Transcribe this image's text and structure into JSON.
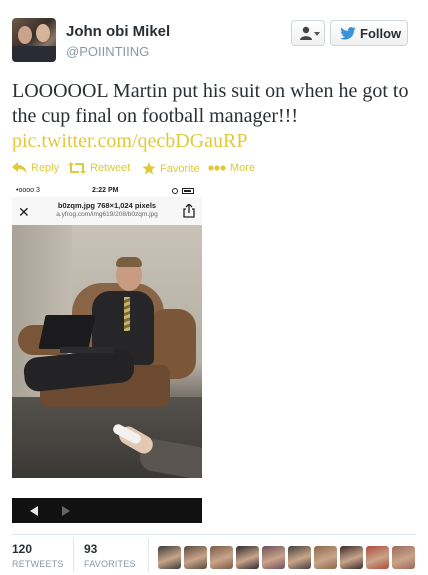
{
  "user": {
    "name": "John obi Mikel",
    "handle": "@POIINTIING",
    "follow_label": "Follow"
  },
  "tweet": {
    "text": "LOOOOOL Martin put his suit on when he got to the cup final on football manager!!! ",
    "link": "pic.twitter.com/qecbDGauRP"
  },
  "actions": [
    {
      "label": "Reply",
      "icon": "reply-icon"
    },
    {
      "label": "Retweet",
      "icon": "retweet-icon"
    },
    {
      "label": "Favorite",
      "icon": "star-icon"
    },
    {
      "label": "More",
      "icon": "more-icon"
    }
  ],
  "photo": {
    "carrier": "•oooo 3",
    "time": "2:22 PM",
    "filename": "b0zqm.jpg 768×1,024 pixels",
    "url": "a.yfrog.com/img619/208/b0zqm.jpg",
    "close_glyph": "✕"
  },
  "stats": {
    "retweets": {
      "count": "120",
      "label": "RETWEETS"
    },
    "favorites": {
      "count": "93",
      "label": "FAVORITES"
    }
  },
  "colors": {
    "accent": "#e0c93a",
    "text": "#292f33",
    "muted": "#8899a6",
    "follow_bird": "#3b94d9"
  },
  "favoriters": [
    {
      "color": "#3d3a3a"
    },
    {
      "color": "#5a4a3e"
    },
    {
      "color": "#7a5a48"
    },
    {
      "color": "#2e2a2c"
    },
    {
      "color": "#6e4e5a"
    },
    {
      "color": "#45403a"
    },
    {
      "color": "#8a6a4a"
    },
    {
      "color": "#3a2a2a"
    },
    {
      "color": "#b04a3a"
    },
    {
      "color": "#9a6a5a"
    }
  ]
}
